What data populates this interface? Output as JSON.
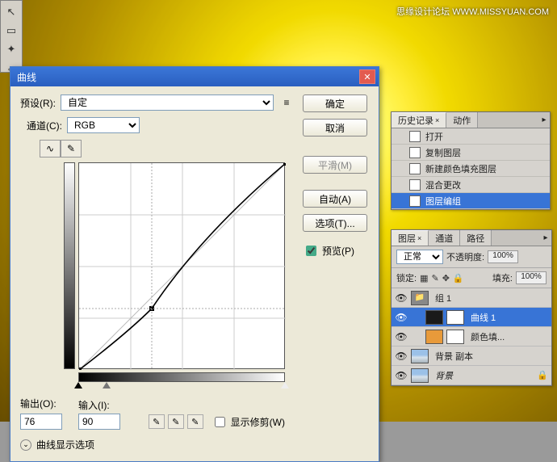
{
  "watermark": "思缘设计论坛  WWW.MISSYUAN.COM",
  "toolbar": {
    "tools": [
      "↖",
      "□",
      "✦",
      "↔"
    ]
  },
  "dialog": {
    "title": "曲线",
    "preset_label": "预设(R):",
    "preset_value": "自定",
    "channel_label": "通道(C):",
    "channel_value": "RGB",
    "output_label": "输出(O):",
    "output_value": "76",
    "input_label": "输入(I):",
    "input_value": "90",
    "show_clipping": "显示修剪(W)",
    "expand": "曲线显示选项",
    "buttons": {
      "ok": "确定",
      "cancel": "取消",
      "smooth": "平滑(M)",
      "auto": "自动(A)",
      "options": "选项(T)...",
      "preview": "预览(P)"
    }
  },
  "chart_data": {
    "type": "line",
    "title": "曲线",
    "xlabel": "输入",
    "ylabel": "输出",
    "xlim": [
      0,
      255
    ],
    "ylim": [
      0,
      255
    ],
    "series": [
      {
        "name": "baseline",
        "x": [
          0,
          255
        ],
        "y": [
          0,
          255
        ]
      },
      {
        "name": "curve",
        "x": [
          0,
          90,
          255
        ],
        "y": [
          0,
          76,
          255
        ]
      }
    ],
    "points": [
      {
        "x": 90,
        "y": 76
      }
    ]
  },
  "history": {
    "tab1": "历史记录",
    "tab2": "动作",
    "items": [
      {
        "label": "打开",
        "sel": false
      },
      {
        "label": "复制图层",
        "sel": false
      },
      {
        "label": "新建颜色填充图层",
        "sel": false
      },
      {
        "label": "混合更改",
        "sel": false
      },
      {
        "label": "图层编组",
        "sel": true
      }
    ]
  },
  "layers": {
    "tab1": "图层",
    "tab2": "通道",
    "tab3": "路径",
    "blend_label": "正常",
    "opacity_label": "不透明度:",
    "opacity_value": "100%",
    "lock_label": "锁定:",
    "fill_label": "填充:",
    "fill_value": "100%",
    "items": [
      {
        "name": "组 1",
        "type": "group",
        "sel": false,
        "indent": 0
      },
      {
        "name": "曲线 1",
        "type": "curves",
        "sel": true,
        "indent": 1
      },
      {
        "name": "颜色填...",
        "type": "fill",
        "sel": false,
        "indent": 1
      },
      {
        "name": "背景 副本",
        "type": "image",
        "sel": false,
        "indent": 0
      },
      {
        "name": "背景",
        "type": "image",
        "sel": false,
        "indent": 0,
        "locked": true
      }
    ]
  }
}
